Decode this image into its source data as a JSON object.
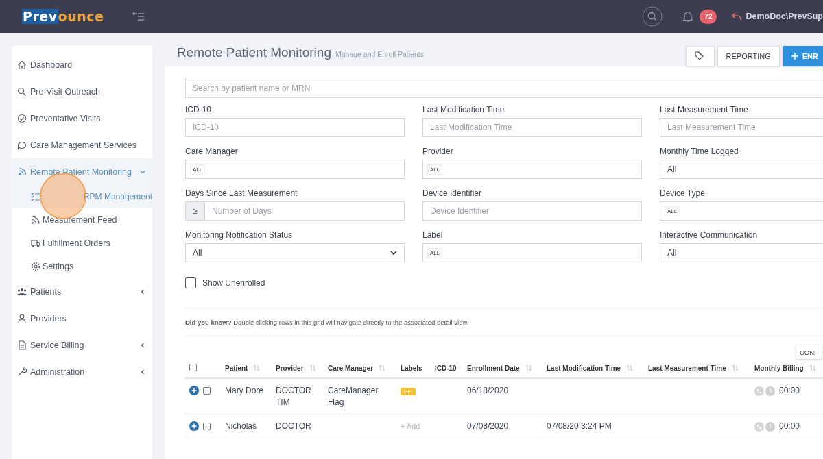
{
  "topbar": {
    "logo": {
      "part_1": "Prev",
      "part_2": "ounce"
    },
    "notifications": "72",
    "user": "DemoDoc\\PrevSup"
  },
  "sidebar": {
    "items": [
      {
        "label": "Dashboard",
        "kind": "link",
        "selected": false
      },
      {
        "label": "Pre-Visit Outreach",
        "kind": "link",
        "selected": false
      },
      {
        "label": "Preventative Visits",
        "kind": "link",
        "selected": false
      },
      {
        "label": "Care Management Services",
        "kind": "link",
        "selected": false
      },
      {
        "label": "Remote Patient Monitoring",
        "kind": "group",
        "selected": true,
        "expanded": true,
        "children": [
          {
            "label": "RPM Management",
            "selected": true
          },
          {
            "label": "Measurement Feed",
            "selected": false
          },
          {
            "label": "Fulfillment Orders",
            "selected": false
          },
          {
            "label": "Settings",
            "selected": false
          }
        ]
      },
      {
        "label": "Patients",
        "kind": "group",
        "selected": false,
        "expanded": false
      },
      {
        "label": "Providers",
        "kind": "link",
        "selected": false
      },
      {
        "label": "Service Billing",
        "kind": "group",
        "selected": false,
        "expanded": false
      },
      {
        "label": "Administration",
        "kind": "group",
        "selected": false,
        "expanded": false
      }
    ]
  },
  "page": {
    "title": "Remote Patient Monitoring",
    "subtitle": "Manage and Enroll Patients",
    "buttons": {
      "reporting": "REPORTING",
      "enroll": "ENR"
    }
  },
  "filters": {
    "search": {
      "placeholder": "Search by patient name or MRN"
    },
    "fields": [
      {
        "label": "ICD-10",
        "kind": "text",
        "placeholder": "ICD-10"
      },
      {
        "label": "Last Modification Time",
        "kind": "text",
        "placeholder": "Last Modification Time"
      },
      {
        "label": "Last Measurement Time",
        "kind": "text",
        "placeholder": "Last Measurement Time"
      },
      {
        "label": "Care Manager",
        "kind": "tags",
        "value": "ALL"
      },
      {
        "label": "Provider",
        "kind": "tags",
        "value": "ALL"
      },
      {
        "label": "Monthly Time Logged",
        "kind": "select",
        "value": "All"
      },
      {
        "label": "Days Since Last Measurement",
        "kind": "prefixed",
        "prefix": "≥",
        "placeholder": "Number of Days"
      },
      {
        "label": "Device Identifier",
        "kind": "text",
        "placeholder": "Device Identifier"
      },
      {
        "label": "Device Type",
        "kind": "tags",
        "value": "ALL"
      },
      {
        "label": "Monitoring Notification Status",
        "kind": "select",
        "value": "All"
      },
      {
        "label": "Label",
        "kind": "tags",
        "value": "ALL"
      },
      {
        "label": "Interactive Communication",
        "kind": "select",
        "value": "All"
      }
    ],
    "show_unenrolled": {
      "label": "Show Unenrolled",
      "checked": false
    }
  },
  "tip": "**Did you know?** Double clicking rows in this grid will navigate directly to the associated detail view.",
  "config_button": "CONF",
  "table": {
    "all_checked": false,
    "columns": [
      {
        "label": "Patient",
        "sortable": true
      },
      {
        "label": "Provider",
        "sortable": true
      },
      {
        "label": "Care Manager",
        "sortable": true
      },
      {
        "label": "Labels",
        "sortable": false
      },
      {
        "label": "ICD-10",
        "sortable": false
      },
      {
        "label": "Enrollment Date",
        "sortable": true
      },
      {
        "label": "Last Modification Time",
        "sortable": true
      },
      {
        "label": "Last Measurement Time",
        "sortable": true
      },
      {
        "label": "Monthly Billing",
        "sortable": true
      }
    ],
    "rows": [
      {
        "checked": false,
        "patient": "Mary Dore",
        "provider": "DOCTOR TIM",
        "care_manager": "CareManager Flag",
        "label": {
          "kind": "tag",
          "text": "HH"
        },
        "icd10": "",
        "enrollment_date": "06/18/2020",
        "last_modification": "",
        "last_measurement": "",
        "billing": "00:00"
      },
      {
        "checked": false,
        "patient": "Nicholas",
        "provider": "DOCTOR",
        "care_manager": "",
        "label": {
          "kind": "add",
          "text": "+ Add"
        },
        "icd10": "",
        "enrollment_date": "07/08/2020",
        "last_modification": "07/08/20 3:24 PM",
        "last_measurement": "",
        "billing": "00:00"
      }
    ]
  }
}
